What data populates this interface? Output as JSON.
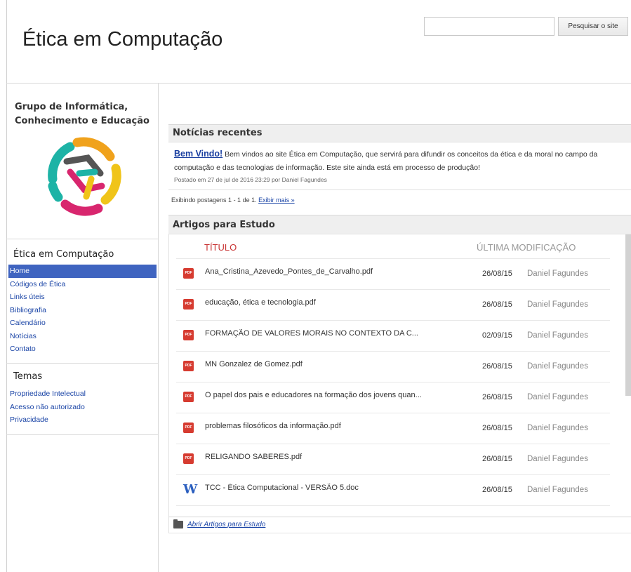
{
  "header": {
    "site_title": "Ética em Computação",
    "search_placeholder": "",
    "search_button": "Pesquisar o site"
  },
  "sidebar": {
    "group_name": "Grupo de Informática, Conhecimento e Educação",
    "nav_heading": "Ética em Computação",
    "nav_items": [
      "Home",
      "Códigos de Ética",
      "Links úteis",
      "Bibliografia",
      "Calendário",
      "Notícias",
      "Contato"
    ],
    "active_item": "Home",
    "themes_heading": "Temas",
    "theme_items": [
      "Propriedade Intelectual",
      "Acesso não autorizado",
      "Privacidade"
    ]
  },
  "news": {
    "heading": "Notícias recentes",
    "item_title": "Bem Vindo!",
    "item_text": "Bem vindos ao site Ética em Computação, que servirá para difundir os conceitos da ética e da moral no campo da computação e das tecnologias de informação. Este site ainda está em processo de produção!",
    "item_meta": "Postado em 27 de jul de 2016 23:29 por Daniel Fagundes",
    "posts_count": "Exibindo postagens 1 - 1 de 1.",
    "show_more": "Exibir mais »"
  },
  "articles": {
    "heading": "Artigos para Estudo",
    "col_title": "TÍTULO",
    "col_modified": "ÚLTIMA MODIFICAÇÃO",
    "files": [
      {
        "icon": "pdf-icon",
        "name": "Ana_Cristina_Azevedo_Pontes_de_Carvalho.pdf",
        "date": "26/08/15",
        "user": "Daniel Fagundes"
      },
      {
        "icon": "pdf-icon",
        "name": "educação, ética e tecnologia.pdf",
        "date": "26/08/15",
        "user": "Daniel Fagundes"
      },
      {
        "icon": "pdf-icon",
        "name": "FORMAÇÃO DE VALORES MORAIS NO CONTEXTO DA C...",
        "date": "02/09/15",
        "user": "Daniel Fagundes"
      },
      {
        "icon": "pdf-icon",
        "name": "MN Gonzalez de Gomez.pdf",
        "date": "26/08/15",
        "user": "Daniel Fagundes"
      },
      {
        "icon": "pdf-icon",
        "name": "O papel dos pais e educadores na formação dos jovens quan...",
        "date": "26/08/15",
        "user": "Daniel Fagundes"
      },
      {
        "icon": "pdf-icon",
        "name": "problemas filosóficos da informação.pdf",
        "date": "26/08/15",
        "user": "Daniel Fagundes"
      },
      {
        "icon": "pdf-icon",
        "name": "RELIGANDO SABERES.pdf",
        "date": "26/08/15",
        "user": "Daniel Fagundes"
      },
      {
        "icon": "word-doc-icon",
        "name": "TCC - Ética Computacional - VERSÃO 5.doc",
        "date": "26/08/15",
        "user": "Daniel Fagundes"
      }
    ],
    "pdf_badge": "PDF",
    "doc_badge": "W",
    "open_folder_link": "Abrir Artigos para Estudo"
  },
  "colors": {
    "link": "#1a44a6",
    "active_nav": "#3f64c0",
    "title_column": "#c83333",
    "pdf": "#d63b30",
    "doc": "#2b5fbf"
  }
}
